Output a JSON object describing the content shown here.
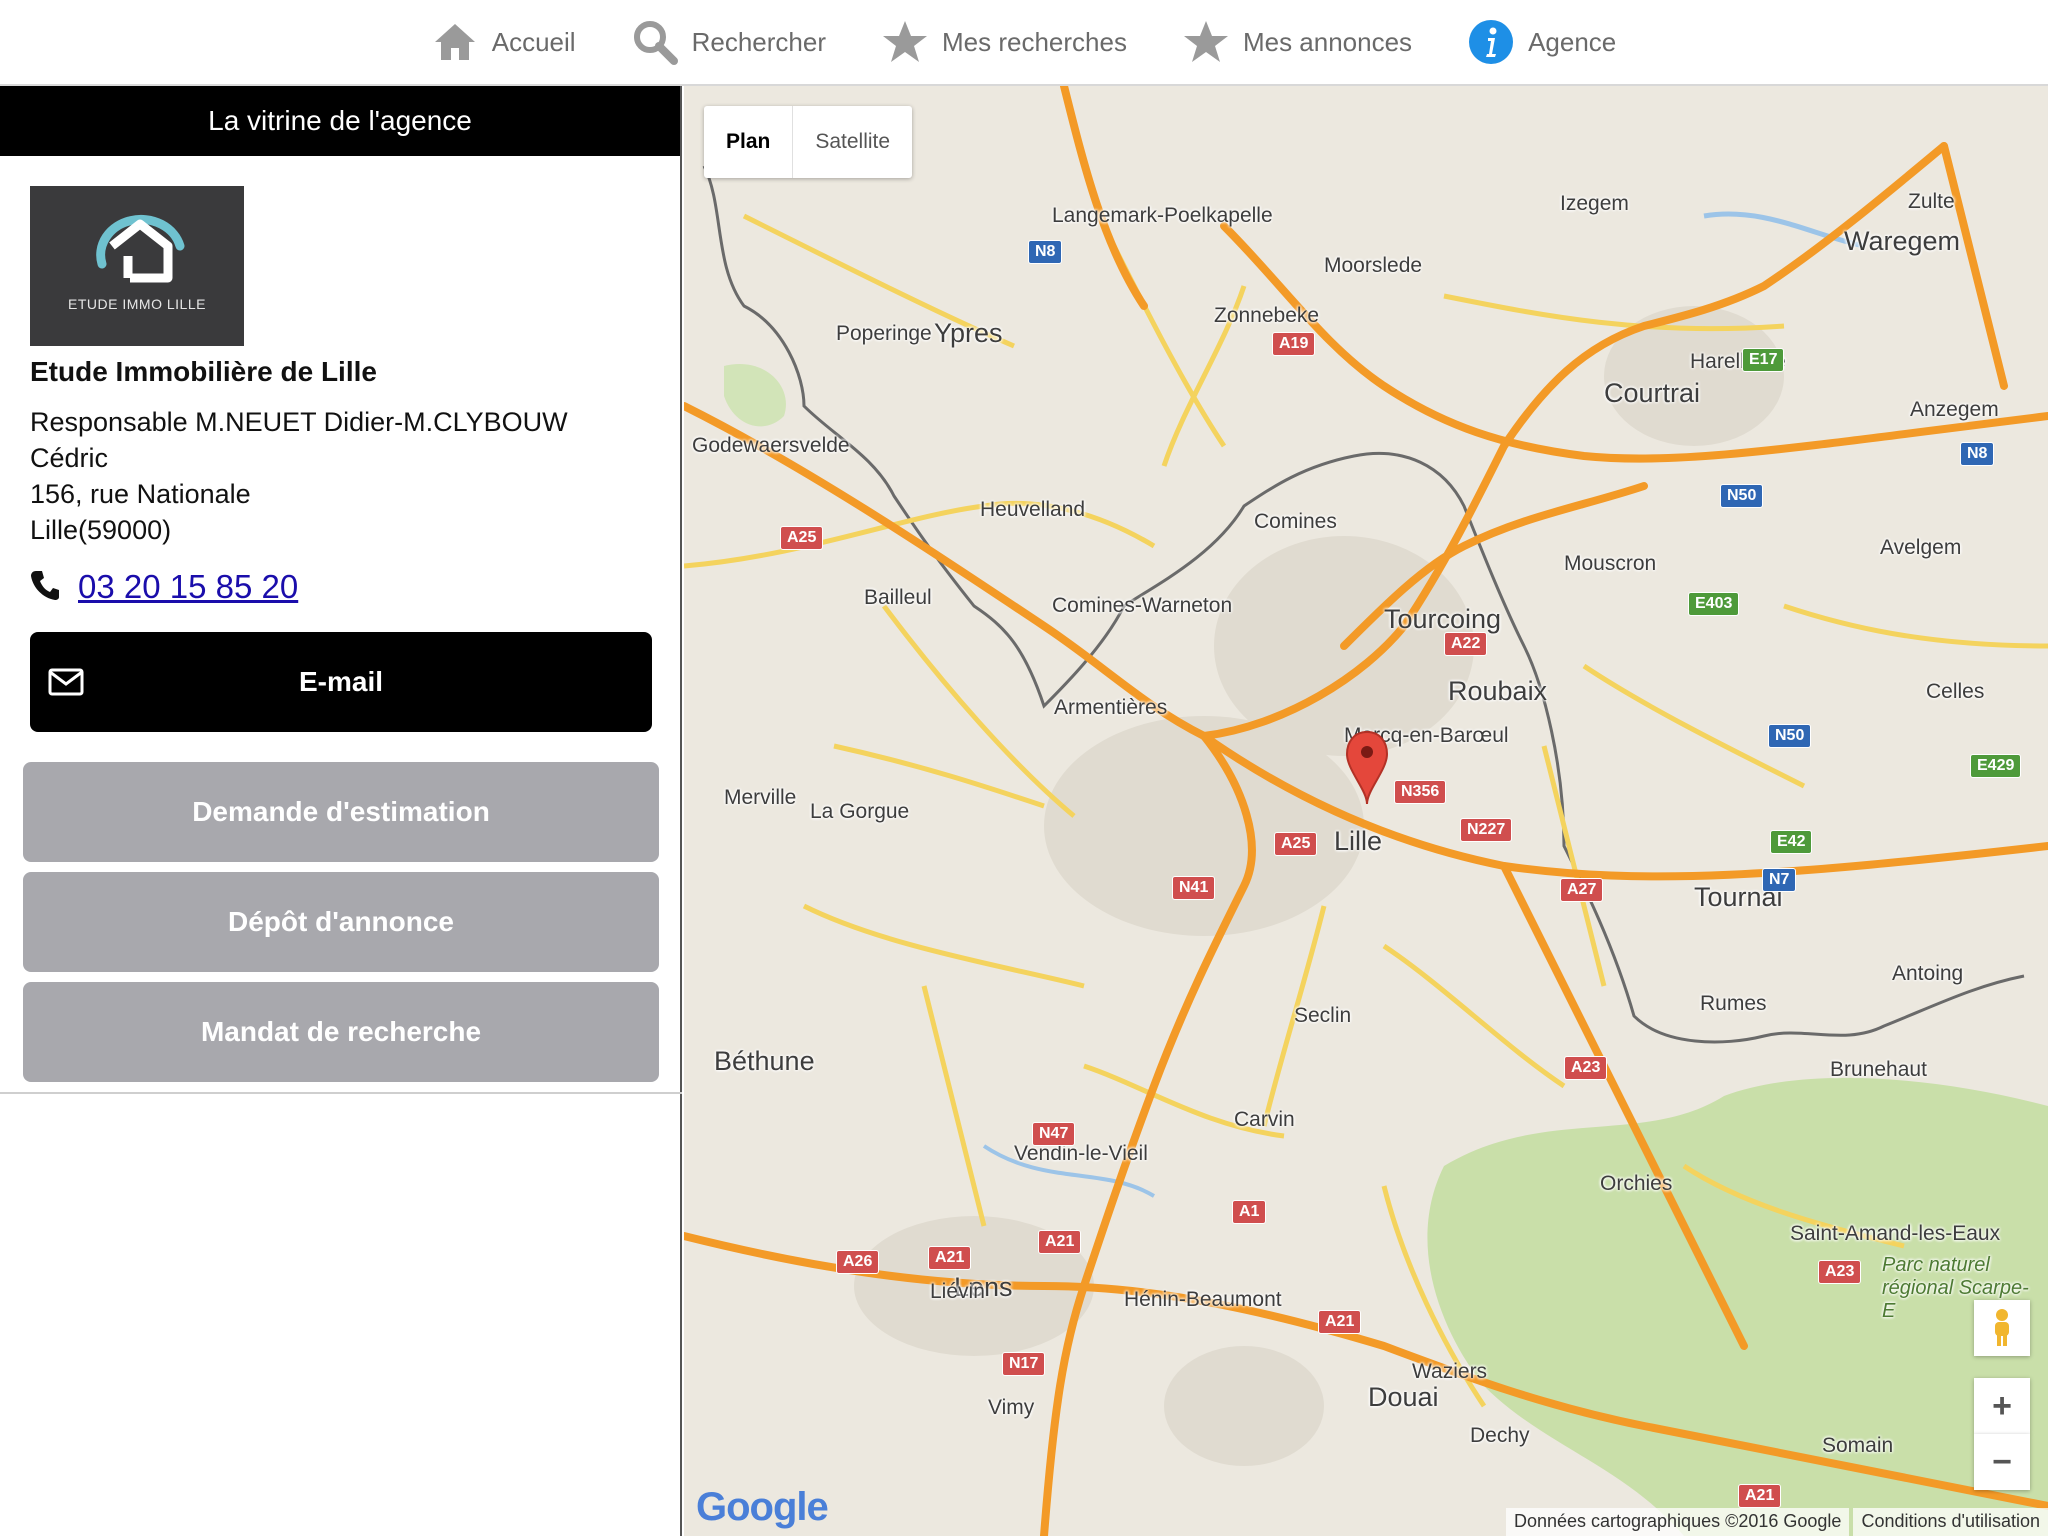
{
  "nav": {
    "items": [
      {
        "label": "Accueil",
        "icon": "home-icon"
      },
      {
        "label": "Rechercher",
        "icon": "search-icon"
      },
      {
        "label": "Mes recherches",
        "icon": "star-icon"
      },
      {
        "label": "Mes annonces",
        "icon": "star-icon"
      },
      {
        "label": "Agence",
        "icon": "info-icon"
      }
    ]
  },
  "panel": {
    "header": "La vitrine de l'agence",
    "logo_text": "ETUDE IMMO LILLE",
    "agency_name": "Etude Immobilière de Lille",
    "info_lines": [
      "Responsable M.NEUET Didier-M.CLYBOUW Cédric",
      "156, rue Nationale",
      "Lille(59000)"
    ],
    "phone": "03 20 15 85 20",
    "email_label": "E-mail",
    "buttons": [
      "Demande d'estimation",
      "Dépôt d'annonce",
      "Mandat de recherche"
    ]
  },
  "map": {
    "type_plan": "Plan",
    "type_satellite": "Satellite",
    "zoom_in": "+",
    "zoom_out": "−",
    "attribution": "Données cartographiques ©2016 Google",
    "terms": "Conditions d'utilisation",
    "logo": "Google",
    "places": [
      {
        "name": "Lille",
        "big": true
      },
      {
        "name": "Roubaix",
        "big": true
      },
      {
        "name": "Tourcoing",
        "big": true
      },
      {
        "name": "Courtrai",
        "big": true
      },
      {
        "name": "Mouscron",
        "big": false
      },
      {
        "name": "Ypres",
        "big": true
      },
      {
        "name": "Tournai",
        "big": true
      },
      {
        "name": "Béthune",
        "big": true
      },
      {
        "name": "Lens",
        "big": true
      },
      {
        "name": "Douai",
        "big": true
      },
      {
        "name": "Waregem",
        "big": true
      },
      {
        "name": "Armentières",
        "big": false
      },
      {
        "name": "Marcq-en-Barœul",
        "big": false
      },
      {
        "name": "Seclin",
        "big": false
      },
      {
        "name": "Carvin",
        "big": false
      },
      {
        "name": "Comines",
        "big": false
      },
      {
        "name": "Comines-Warneton",
        "big": false
      },
      {
        "name": "Heuvelland",
        "big": false
      },
      {
        "name": "Bailleul",
        "big": false
      },
      {
        "name": "Poperinge",
        "big": false
      },
      {
        "name": "Godewaersvelde",
        "big": false
      },
      {
        "name": "Langemark-Poelkapelle",
        "big": false
      },
      {
        "name": "Moorslede",
        "big": false
      },
      {
        "name": "Zonnebeke",
        "big": false
      },
      {
        "name": "Izegem",
        "big": false
      },
      {
        "name": "Zulte",
        "big": false
      },
      {
        "name": "Harelbeke",
        "big": false
      },
      {
        "name": "Anzegem",
        "big": false
      },
      {
        "name": "Avelgem",
        "big": false
      },
      {
        "name": "Celles",
        "big": false
      },
      {
        "name": "Merville",
        "big": false
      },
      {
        "name": "La Gorgue",
        "big": false
      },
      {
        "name": "Vendin-le-Vieil",
        "big": false
      },
      {
        "name": "Liévin",
        "big": false
      },
      {
        "name": "Hénin-Beaumont",
        "big": false
      },
      {
        "name": "Vimy",
        "big": false
      },
      {
        "name": "Waziers",
        "big": false
      },
      {
        "name": "Dechy",
        "big": false
      },
      {
        "name": "Orchies",
        "big": false
      },
      {
        "name": "Rumes",
        "big": false
      },
      {
        "name": "Antoing",
        "big": false
      },
      {
        "name": "Brunehaut",
        "big": false
      },
      {
        "name": "Saint-Amand-les-Eaux",
        "big": false
      },
      {
        "name": "Somain",
        "big": false
      },
      {
        "name": "Parc naturel régional Scarpe-E",
        "big": false
      }
    ],
    "road_shields": [
      "A25",
      "A22",
      "N356",
      "N227",
      "A27",
      "N41",
      "A19",
      "N8",
      "E17",
      "N50",
      "E403",
      "N50",
      "E429",
      "E42",
      "N7",
      "A23",
      "A1",
      "N47",
      "A21",
      "A26",
      "A21",
      "N17",
      "A21",
      "A23",
      "A21",
      "A25",
      "N8"
    ]
  }
}
